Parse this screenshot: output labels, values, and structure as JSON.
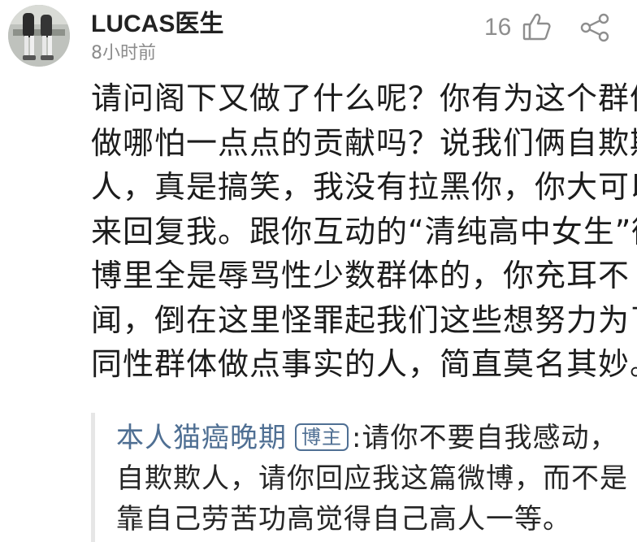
{
  "comment": {
    "avatar_icon": "avatar-photo",
    "username": "LUCAS医生",
    "timestamp": "8小时前",
    "like_count": "16",
    "like_icon": "thumbs-up-icon",
    "share_icon": "share-icon",
    "body_lines": [
      "请问阁下又做了什么呢？你有为这个群体",
      "做哪怕一点点的贡献吗？说我们俩自欺欺",
      "人，真是搞笑，我没有拉黑你，你大可以",
      "来回复我。跟你互动的“清纯高中女生”微",
      "博里全是辱骂性少数群体的，你充耳不",
      "闻，倒在这里怪罪起我们这些想努力为了",
      "同性群体做点事实的人，简直莫名其妙。"
    ]
  },
  "reply": {
    "author": "本人猫癌晚期",
    "badge": "博主",
    "separator": ":",
    "text_line_1": "请你不要自我感动，",
    "line_2": "自欺欺人，请你回应我这篇微博，而不是",
    "line_3": "靠自己劳苦功高觉得自己高人一等。"
  },
  "colors": {
    "link_blue": "#4f6f93",
    "meta_gray": "#8c8c8c",
    "text": "#1c1c1c",
    "reply_border": "#e6e6e6"
  }
}
